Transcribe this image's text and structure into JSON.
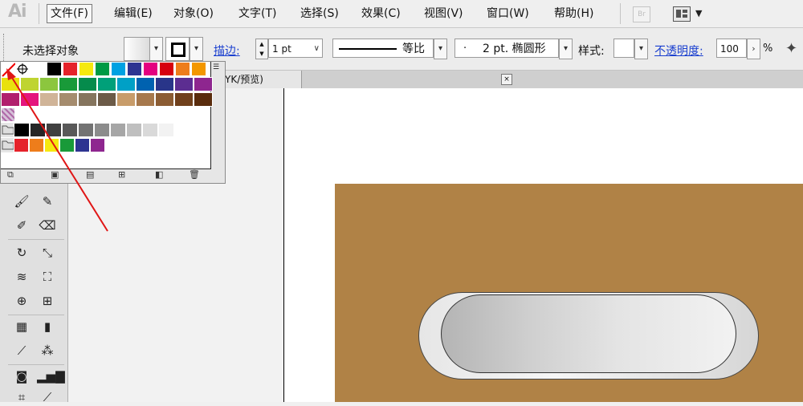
{
  "app": {
    "logo": "Ai"
  },
  "menu": {
    "items": [
      "文件(F)",
      "编辑(E)",
      "对象(O)",
      "文字(T)",
      "选择(S)",
      "效果(C)",
      "视图(V)",
      "窗口(W)",
      "帮助(H)"
    ],
    "active_index": 0,
    "bridge_label": "Br"
  },
  "control": {
    "selection_status": "未选择对象",
    "stroke_label": "描边:",
    "stroke_weight": "1 pt",
    "profile_label": "等比",
    "brush": "2 pt. 椭圆形",
    "style_label": "样式:",
    "opacity_label": "不透明度:",
    "opacity_value": "100",
    "opacity_unit": "%"
  },
  "document": {
    "tab_title": "YK/预览)",
    "close_icon": "×"
  },
  "swatches": {
    "row1": [
      "#ffffff",
      "#000000",
      "#e5222a",
      "#f6e90f",
      "#009a44",
      "#00a1e2",
      "#2d3491",
      "#e4007f",
      "#d6000f",
      "#ee7d1b",
      "#f39700"
    ],
    "row2": [
      "#e9e10e",
      "#bfd431",
      "#8cc63e",
      "#199a39",
      "#058b4c",
      "#00a079",
      "#00a0c6",
      "#0062b0",
      "#293589",
      "#5c2d91",
      "#8e268f"
    ],
    "row3": [
      "#b11f6d",
      "#e4157d",
      "#d0b498",
      "#a58c6e",
      "#85755e",
      "#6c5b48",
      "#c89c6a",
      "#a6784c",
      "#8b5c33",
      "#70401c",
      "#5a2c0d"
    ],
    "grays": [
      "#000000",
      "#262626",
      "#404040",
      "#595959",
      "#737373",
      "#8c8c8c",
      "#a6a6a6",
      "#bfbfbf",
      "#d9d9d9",
      "#f2f2f2"
    ],
    "brights": [
      "#e5222a",
      "#ee7d1b",
      "#f6e90f",
      "#199a39",
      "#2d3491",
      "#8e268f"
    ]
  },
  "canvas": {
    "background_color": "#b08246"
  }
}
